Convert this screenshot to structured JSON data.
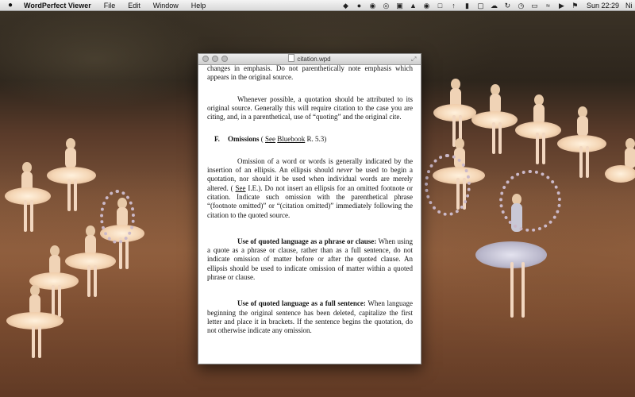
{
  "menubar": {
    "apple": "",
    "app_name": "WordPerfect Viewer",
    "menus": [
      "File",
      "Edit",
      "Window",
      "Help"
    ],
    "clock": "Sun 22:29",
    "user": "Ni"
  },
  "window": {
    "title": "citation.wpd"
  },
  "document": {
    "p1": "changes in emphasis. Do not parenthetically note emphasis which appears in the original source.",
    "p2": "Whenever possible, a quotation should be attributed to its original source. Generally this will require citation to the case you are citing, and, in a parenthetical, use of “quoting” and the original cite.",
    "heading_letter": "F.",
    "heading_word": "Omissions",
    "heading_open": " ( ",
    "heading_see": "See",
    "heading_space": " ",
    "heading_bluebook": "Bluebook",
    "heading_rest": " R. 5.3)",
    "p3_a": "Omission of a word or words is generally indicated by the insertion of an ellipsis. An ellipsis should ",
    "p3_never": "never",
    "p3_b": " be used to begin a quotation, nor should it be used when individual words are merely altered. ( ",
    "p3_see": "See",
    "p3_c": " I.E.). Do not insert an ellipsis for an omitted footnote or citation. Indicate such omission with the parenthetical phrase “(footnote omitted)” or “(citation omitted)” immediately following the citation to the quoted source.",
    "p4_bold": "Use of quoted language as a phrase or clause:",
    "p4_text": " When using a quote as a phrase or clause, rather than as a full sentence, do not indicate omission of matter before or after the quoted clause. An ellipsis should be used to indicate omission of matter within a quoted phrase or clause.",
    "p5_bold": "Use of quoted language as a full sentence:",
    "p5_text": " When language beginning the original sentence has been deleted, capitalize the first letter and place it in brackets. If the sentence begins the quotation, do not otherwise indicate any omission."
  },
  "icons": {
    "apple": "apple-logo-icon",
    "status": [
      "evernote-icon",
      "droplet-icon",
      "globe-icon",
      "record-icon",
      "chat-icon",
      "font-icon",
      "eye-icon",
      "screen-icon",
      "upload-icon",
      "battery-icon",
      "message-icon",
      "cloud-icon",
      "sync-icon",
      "clock-icon",
      "display-icon",
      "wifi-icon",
      "volume-icon",
      "flag-icon"
    ]
  }
}
